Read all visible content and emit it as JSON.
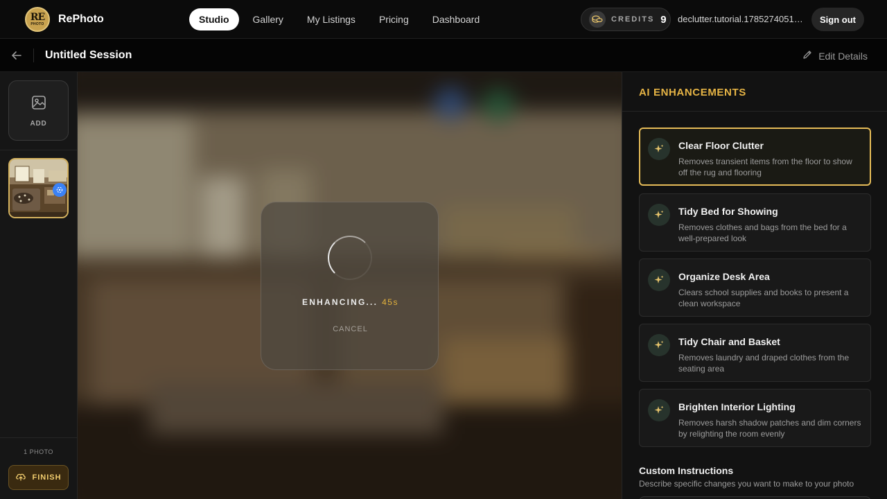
{
  "brand": {
    "logo_text": "RE",
    "logo_sub": "PHOTO",
    "name": "RePhoto"
  },
  "nav": {
    "items": [
      {
        "label": "Studio",
        "active": true
      },
      {
        "label": "Gallery",
        "active": false
      },
      {
        "label": "My Listings",
        "active": false
      },
      {
        "label": "Pricing",
        "active": false
      },
      {
        "label": "Dashboard",
        "active": false
      }
    ]
  },
  "credits": {
    "label": "CREDITS",
    "value": "9",
    "icon": "coins-icon"
  },
  "user": {
    "email": "declutter.tutorial.178527405123...",
    "signout_label": "Sign out"
  },
  "session": {
    "title": "Untitled Session",
    "edit_label": "Edit Details"
  },
  "sidebar": {
    "add_label": "ADD",
    "photo_count": "1  PHOTO",
    "finish_label": "FINISH"
  },
  "enhancing": {
    "status": "ENHANCING...",
    "timer": "45s",
    "cancel_label": "CANCEL"
  },
  "panel": {
    "title": "AI ENHANCEMENTS",
    "enhancements": [
      {
        "title": "Clear Floor Clutter",
        "description": "Removes transient items from the floor to show off the rug and flooring",
        "selected": true
      },
      {
        "title": "Tidy Bed for Showing",
        "description": "Removes clothes and bags from the bed for a well-prepared look",
        "selected": false
      },
      {
        "title": "Organize Desk Area",
        "description": "Clears school supplies and books to present a clean workspace",
        "selected": false
      },
      {
        "title": "Tidy Chair and Basket",
        "description": "Removes laundry and draped clothes from the seating area",
        "selected": false
      },
      {
        "title": "Brighten Interior Lighting",
        "description": "Removes harsh shadow patches and dim corners by relighting the room evenly",
        "selected": false
      }
    ],
    "custom_title": "Custom Instructions",
    "custom_description": "Describe specific changes you want to make to your photo"
  },
  "colors": {
    "accent_gold": "#e6b445",
    "selected_border": "#e6bc58",
    "timer": "#e3b23c",
    "badge_blue": "#3a82f6"
  }
}
